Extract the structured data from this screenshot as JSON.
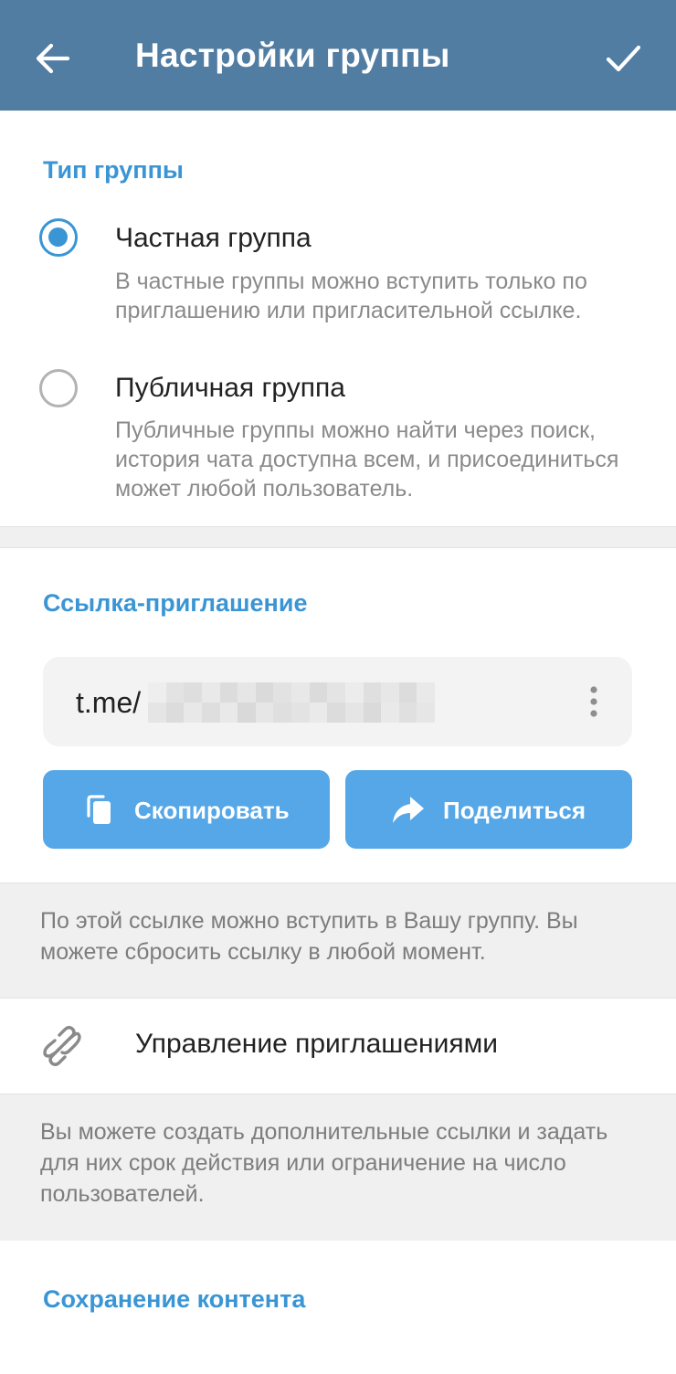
{
  "app_bar": {
    "back_icon": "arrow-left-icon",
    "title": "Настройки группы",
    "done_icon": "checkmark-icon",
    "background": "#517da2"
  },
  "group_type": {
    "section_title": "Тип группы",
    "options": [
      {
        "title": "Частная группа",
        "description": "В частные группы можно вступить только по приглашению или пригласительной ссылке.",
        "selected": true
      },
      {
        "title": "Публичная группа",
        "description": "Публичные группы можно найти через поиск, история чата доступна всем, и присоединиться может любой пользователь.",
        "selected": false
      }
    ]
  },
  "invite_link": {
    "section_title": "Ссылка-приглашение",
    "link_prefix": "t.me/",
    "link_obscured": true,
    "menu_icon": "more-vertical-icon",
    "copy_button": {
      "label": "Скопировать",
      "icon": "copy-icon"
    },
    "share_button": {
      "label": "Поделиться",
      "icon": "share-arrow-icon"
    },
    "hint": "По этой ссылке можно вступить в Вашу группу. Вы можете сбросить ссылку в любой момент."
  },
  "manage_invites": {
    "label": "Управление приглашениями",
    "icon": "link-icon",
    "hint": "Вы можете создать дополнительные ссылки и задать для них срок действия или ограничение на число пользователей."
  },
  "content_saving": {
    "section_title": "Сохранение контента"
  },
  "colors": {
    "accent": "#3a95d5",
    "button": "#55a7e8",
    "hint_text": "#7d7d7d",
    "band": "#f0f0f0"
  }
}
